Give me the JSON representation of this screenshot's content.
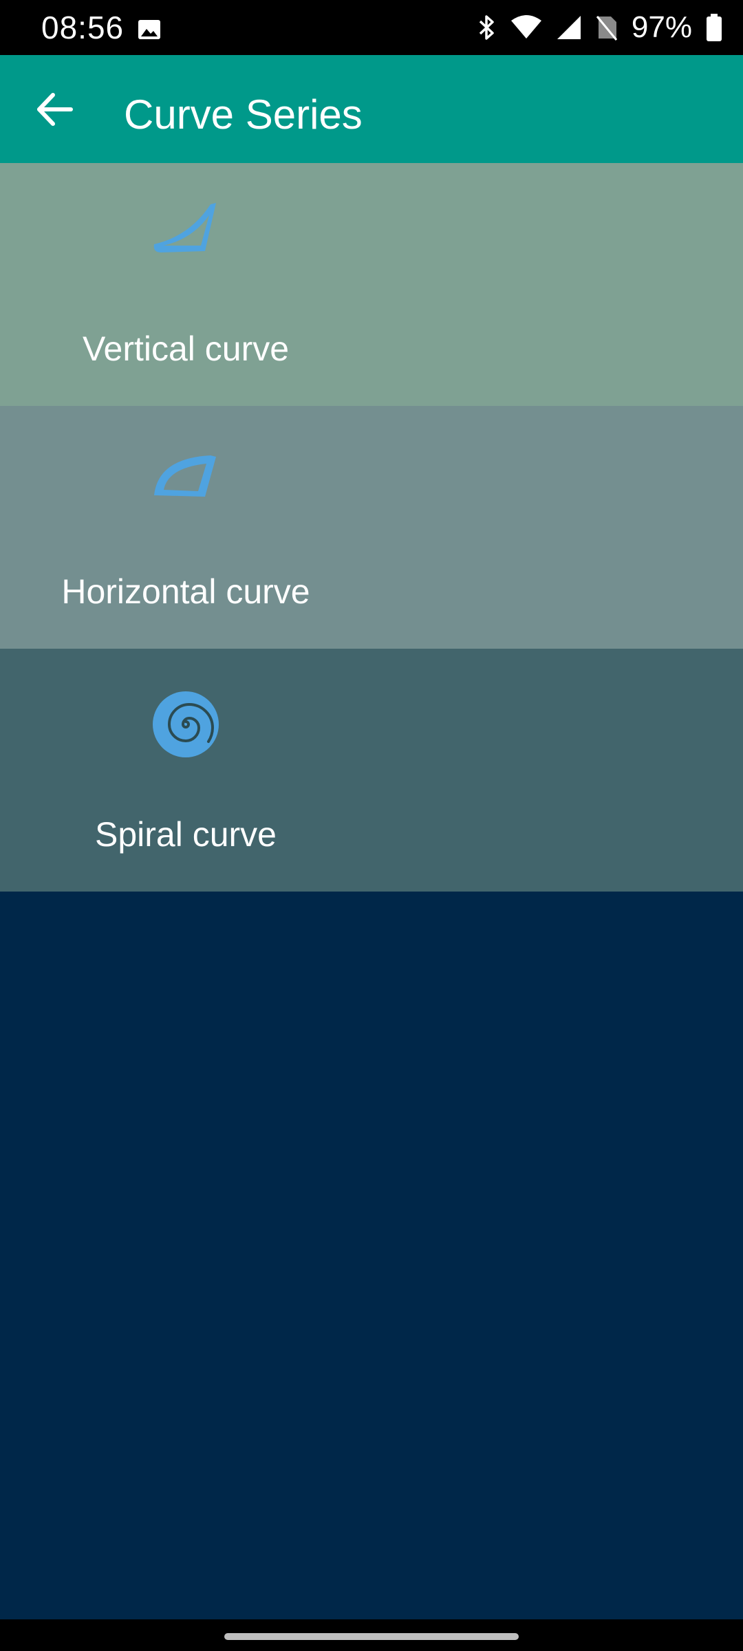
{
  "status_bar": {
    "time": "08:56",
    "battery": "97%",
    "icons": [
      "gallery-icon",
      "bluetooth-icon",
      "wifi-icon",
      "cell-signal-icon",
      "no-sim-icon",
      "battery-icon"
    ]
  },
  "app_bar": {
    "title": "Curve Series",
    "back_icon": "arrow-back-icon"
  },
  "items": [
    {
      "label": "Vertical curve",
      "icon": "vertical-curve-icon"
    },
    {
      "label": "Horizontal curve",
      "icon": "horizontal-curve-icon"
    },
    {
      "label": "Spiral curve",
      "icon": "spiral-curve-icon"
    }
  ],
  "colors": {
    "app_bar": "#00998A",
    "item_vertical": "#7FA193",
    "item_horizontal": "#748F90",
    "item_spiral": "#42656C",
    "background": "#002749",
    "icon_blue": "#4FA3E0"
  }
}
